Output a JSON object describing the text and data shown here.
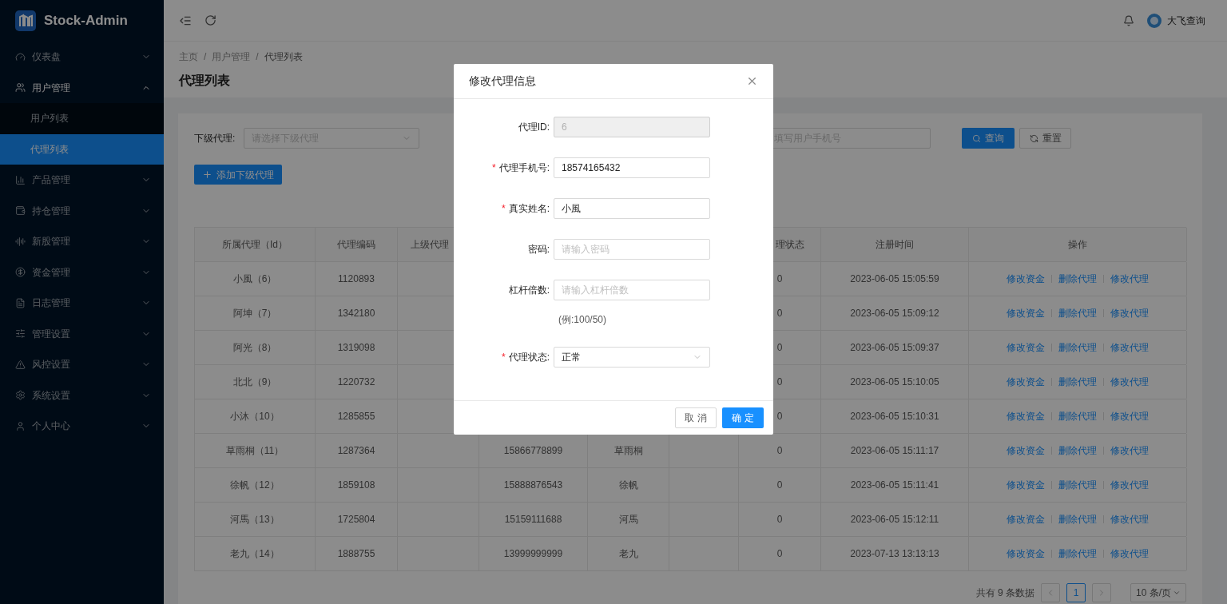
{
  "brand": {
    "name": "Stock-Admin"
  },
  "sidebar": {
    "items": [
      {
        "label": "仪表盘",
        "expanded": false
      },
      {
        "label": "用户管理",
        "expanded": true,
        "children": [
          {
            "label": "用户列表",
            "selected": false
          },
          {
            "label": "代理列表",
            "selected": true
          }
        ]
      },
      {
        "label": "产品管理",
        "expanded": false
      },
      {
        "label": "持仓管理",
        "expanded": false
      },
      {
        "label": "新股管理",
        "expanded": false
      },
      {
        "label": "资金管理",
        "expanded": false
      },
      {
        "label": "日志管理",
        "expanded": false
      },
      {
        "label": "管理设置",
        "expanded": false
      },
      {
        "label": "风控设置",
        "expanded": false
      },
      {
        "label": "系统设置",
        "expanded": false
      },
      {
        "label": "个人中心",
        "expanded": false
      }
    ]
  },
  "header": {
    "user": "大飞查询"
  },
  "breadcrumb": [
    "主页",
    "用户管理",
    "代理列表"
  ],
  "breadcrumb_separator": "/",
  "page_title": "代理列表",
  "filters": {
    "agent_label": "下级代理:",
    "agent_placeholder": "请选择下级代理",
    "phone_placeholder": "填写用户手机号",
    "search_button": "查询",
    "reset_button": "重置"
  },
  "add_button": "添加下级代理",
  "table": {
    "columns": {
      "agent": "所属代理（Id）",
      "code": "代理编码",
      "parent": "上级代理",
      "status": "理状态",
      "time": "注册时间",
      "actions": "操作"
    },
    "rows": [
      {
        "agent": "小風（6）",
        "code": "1120893",
        "status": "0",
        "time": "2023-06-05 15:05:59",
        "actions": [
          "修改资金",
          "删除代理",
          "修改代理"
        ]
      },
      {
        "agent": "阿坤（7）",
        "code": "1342180",
        "status": "0",
        "time": "2023-06-05 15:09:12",
        "actions": [
          "修改资金",
          "删除代理",
          "修改代理"
        ]
      },
      {
        "agent": "阿光（8）",
        "code": "1319098",
        "status": "0",
        "time": "2023-06-05 15:09:37",
        "actions": [
          "修改资金",
          "删除代理",
          "修改代理"
        ]
      },
      {
        "agent": "北北（9）",
        "code": "1220732",
        "status": "0",
        "time": "2023-06-05 15:10:05",
        "actions": [
          "修改资金",
          "删除代理",
          "修改代理"
        ]
      },
      {
        "agent": "小沐（10）",
        "code": "1285855",
        "status": "0",
        "time": "2023-06-05 15:10:31",
        "actions": [
          "修改资金",
          "删除代理",
          "修改代理"
        ]
      },
      {
        "agent": "草雨桐（11）",
        "code": "1287364",
        "phone": "15866778899",
        "name": "草雨桐",
        "status": "0",
        "time": "2023-06-05 15:11:17",
        "actions": [
          "修改资金",
          "删除代理",
          "修改代理"
        ]
      },
      {
        "agent": "徐帆（12）",
        "code": "1859108",
        "phone": "15888876543",
        "name": "徐帆",
        "status": "0",
        "time": "2023-06-05 15:11:41",
        "actions": [
          "修改资金",
          "删除代理",
          "修改代理"
        ]
      },
      {
        "agent": "河馬（13）",
        "code": "1725804",
        "phone": "15159111688",
        "name": "河馬",
        "status": "0",
        "time": "2023-06-05 15:12:11",
        "actions": [
          "修改资金",
          "删除代理",
          "修改代理"
        ]
      },
      {
        "agent": "老九（14）",
        "code": "1888755",
        "phone": "13999999999",
        "name": "老九",
        "status": "0",
        "time": "2023-07-13 13:13:13",
        "actions": [
          "修改资金",
          "删除代理",
          "修改代理"
        ]
      }
    ]
  },
  "pagination": {
    "total": "共有 9 条数据",
    "pages": [
      {
        "label": "1",
        "selected": true
      }
    ],
    "page_size": "10 条/页"
  },
  "modal": {
    "title": "修改代理信息",
    "fields": [
      {
        "kind": "input",
        "label": "代理ID:",
        "required": false,
        "value": "6",
        "disabled": true
      },
      {
        "kind": "input",
        "label": "代理手机号:",
        "required": true,
        "value": "18574165432",
        "disabled": false
      },
      {
        "kind": "input",
        "label": "真实姓名:",
        "required": true,
        "value": "小風",
        "disabled": false
      },
      {
        "kind": "input",
        "label": "密码:",
        "required": false,
        "placeholder": "请输入密码",
        "disabled": false
      },
      {
        "kind": "input",
        "label": "杠杆倍数:",
        "required": false,
        "placeholder": "请输入杠杆倍数",
        "disabled": false,
        "hint": "(例:100/50)"
      },
      {
        "kind": "select",
        "label": "代理状态:",
        "required": true,
        "value": "正常",
        "disabled": false
      }
    ],
    "required_mark": "*",
    "cancel": "取 消",
    "ok": "确 定"
  }
}
